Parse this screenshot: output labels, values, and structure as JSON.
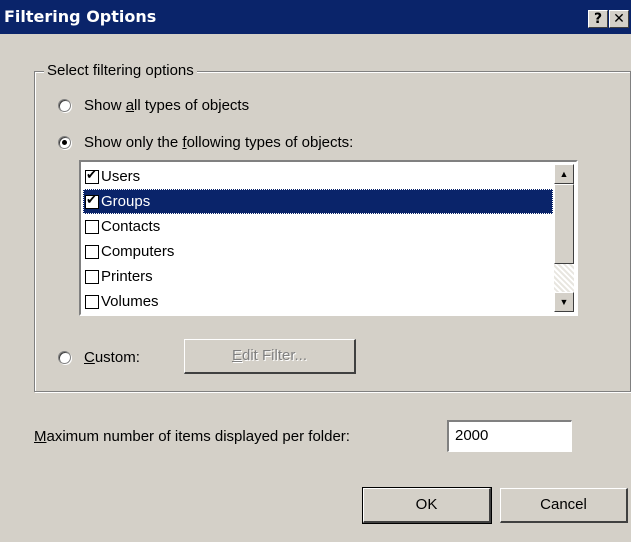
{
  "window": {
    "title": "Filtering Options",
    "help_glyph": "?",
    "close_glyph": "✕"
  },
  "group": {
    "legend": "Select filtering options",
    "radio_all": {
      "pre": "Show ",
      "accel": "a",
      "post": "ll types of objects",
      "checked": false
    },
    "radio_following": {
      "pre": "Show only the ",
      "accel": "f",
      "post": "ollowing types of objects:",
      "checked": true
    },
    "object_types": [
      {
        "label": "Users",
        "checked": true,
        "selected": false
      },
      {
        "label": "Groups",
        "checked": true,
        "selected": true
      },
      {
        "label": "Contacts",
        "checked": false,
        "selected": false
      },
      {
        "label": "Computers",
        "checked": false,
        "selected": false
      },
      {
        "label": "Printers",
        "checked": false,
        "selected": false
      },
      {
        "label": "Volumes",
        "checked": false,
        "selected": false
      }
    ],
    "radio_custom": {
      "accel": "C",
      "post": "ustom:",
      "checked": false
    },
    "edit_filter": {
      "accel": "E",
      "post": "dit Filter...",
      "enabled": false
    }
  },
  "max_items": {
    "label_accel": "M",
    "label_rest": "aximum number of items displayed per folder:",
    "value": "2000"
  },
  "buttons": {
    "ok": "OK",
    "cancel": "Cancel"
  },
  "icons": {
    "scroll_up": "scroll-up-arrow-icon",
    "scroll_down": "scroll-down-arrow-icon",
    "check": "checkmark-icon"
  }
}
